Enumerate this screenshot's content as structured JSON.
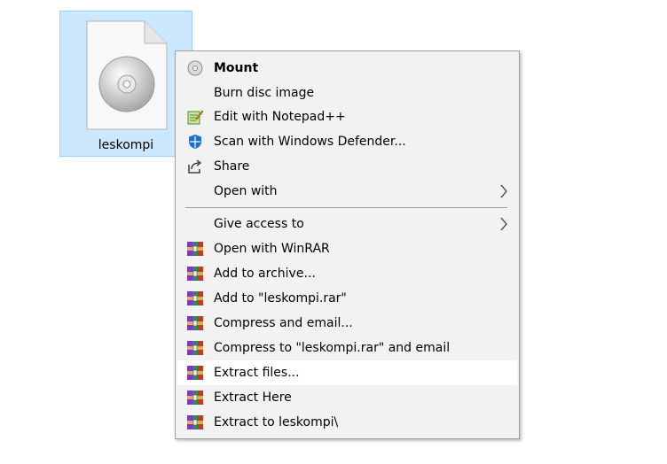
{
  "file": {
    "name": "leskompi",
    "icon": "disc-image-file-icon"
  },
  "menu": {
    "items": [
      {
        "label": "Mount",
        "icon": "disc-icon",
        "bold": true
      },
      {
        "label": "Burn disc image",
        "icon": ""
      },
      {
        "label": "Edit with Notepad++",
        "icon": "notepad-plus-plus-icon"
      },
      {
        "label": "Scan with Windows Defender...",
        "icon": "windows-defender-shield-icon"
      },
      {
        "label": "Share",
        "icon": "share-icon"
      },
      {
        "label": "Open with",
        "icon": "",
        "submenu": true
      },
      {
        "label": "Give access to",
        "icon": "",
        "submenu": true
      },
      {
        "label": "Open with WinRAR",
        "icon": "winrar-icon"
      },
      {
        "label": "Add to archive...",
        "icon": "winrar-icon"
      },
      {
        "label": "Add to \"leskompi.rar\"",
        "icon": "winrar-icon"
      },
      {
        "label": "Compress and email...",
        "icon": "winrar-icon"
      },
      {
        "label": "Compress to \"leskompi.rar\" and email",
        "icon": "winrar-icon"
      },
      {
        "label": "Extract files...",
        "icon": "winrar-icon",
        "highlighted": true
      },
      {
        "label": "Extract Here",
        "icon": "winrar-icon"
      },
      {
        "label": "Extract to leskompi\\",
        "icon": "winrar-icon"
      }
    ]
  },
  "colors": {
    "selection": "#cce8ff",
    "menu_background": "#f2f2f2",
    "menu_border": "#a0a0a0",
    "hover": "#ffffff"
  }
}
